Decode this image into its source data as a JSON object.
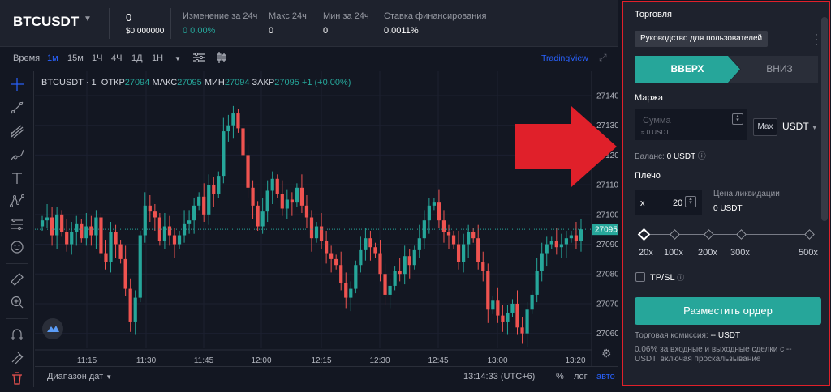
{
  "header": {
    "symbol": "BTCUSDT",
    "stats": [
      {
        "label": "",
        "value": "0",
        "sub": "$0.000000"
      },
      {
        "label": "Изменение за 24ч",
        "value": "0 0.00%"
      },
      {
        "label": "Макс 24ч",
        "value": "0"
      },
      {
        "label": "Мин за 24ч",
        "value": "0"
      },
      {
        "label": "Ставка финансирования",
        "value": "0.0011%"
      }
    ]
  },
  "toolbar": {
    "time_label": "Время",
    "intervals": [
      "1м",
      "15м",
      "1Ч",
      "4Ч",
      "1Д",
      "1Н"
    ],
    "active_interval": "1м",
    "tradingview": "TradingView"
  },
  "ohlc": {
    "symbol": "BTCUSDT · 1",
    "open_label": "ОТКР",
    "open": "27094",
    "high_label": "МАКС",
    "high": "27095",
    "low_label": "МИН",
    "low": "27094",
    "close_label": "ЗАКР",
    "close": "27095",
    "change": "+1 (+0.00%)"
  },
  "chart_data": {
    "type": "candlestick",
    "y_ticks": [
      27140,
      27130,
      27120,
      27110,
      27100,
      27090,
      27080,
      27070,
      27060
    ],
    "x_ticks": [
      "11:15",
      "11:30",
      "11:45",
      "12:00",
      "12:15",
      "12:30",
      "12:45",
      "13:00",
      "13:20"
    ],
    "last_price": "27095",
    "ylim": [
      27055,
      27146
    ],
    "closes": [
      27098,
      27099,
      27093,
      27100,
      27094,
      27090,
      27094,
      27097,
      27092,
      27096,
      27093,
      27099,
      27087,
      27084,
      27094,
      27090,
      27085,
      27075,
      27064,
      27072,
      27093,
      27103,
      27101,
      27099,
      27091,
      27096,
      27093,
      27090,
      27093,
      27097,
      27098,
      27103,
      27106,
      27100,
      27110,
      27107,
      27113,
      27128,
      27130,
      27134,
      27129,
      27120,
      27109,
      27103,
      27096,
      27101,
      27108,
      27112,
      27107,
      27102,
      27105,
      27104,
      27109,
      27103,
      27099,
      27092,
      27096,
      27091,
      27087,
      27085,
      27083,
      27077,
      27072,
      27075,
      27083,
      27088,
      27092,
      27089,
      27087,
      27080,
      27073,
      27076,
      27081,
      27080,
      27086,
      27083,
      27088,
      27092,
      27098,
      27103,
      27104,
      27098,
      27094,
      27093,
      27090,
      27084,
      27090,
      27094,
      27092,
      27084,
      27081,
      27068,
      27071,
      27066,
      27064,
      27067,
      27070,
      27062,
      27060,
      27068,
      27073,
      27081,
      27087,
      27090,
      27091,
      27089,
      27090,
      27092,
      27093,
      27091,
      27095
    ]
  },
  "bottom": {
    "range": "Диапазон дат",
    "time": "13:14:33 (UTC+6)",
    "pct": "%",
    "log": "лог",
    "auto": "авто"
  },
  "panel": {
    "title": "Торговля",
    "guide": "Руководство для пользователей",
    "up": "ВВЕРХ",
    "down": "ВНИЗ",
    "margin_label": "Маржа",
    "amount_placeholder": "Сумма",
    "amount_sub": "≈ 0 USDT",
    "max": "Max",
    "currency": "USDT",
    "balance_label": "Баланс:",
    "balance_value": "0 USDT",
    "leverage_label": "Плечо",
    "leverage_x": "x",
    "leverage_value": "20",
    "liq_label": "Цена ликвидации",
    "liq_value": "0 USDT",
    "slider_labels": [
      "20x",
      "100x",
      "200x",
      "300x",
      "500x"
    ],
    "tpsl": "TP/SL",
    "place_order": "Разместить ордер",
    "fee_label": "Торговая комиссия:",
    "fee_value": "-- USDT",
    "fee_note": "0.06% за входные и выходные сделки с -- USDT, включая проскальзывание"
  },
  "colors": {
    "up": "#26a69a",
    "down": "#ef5350",
    "accent": "#2962ff",
    "highlight": "#e0202a"
  }
}
